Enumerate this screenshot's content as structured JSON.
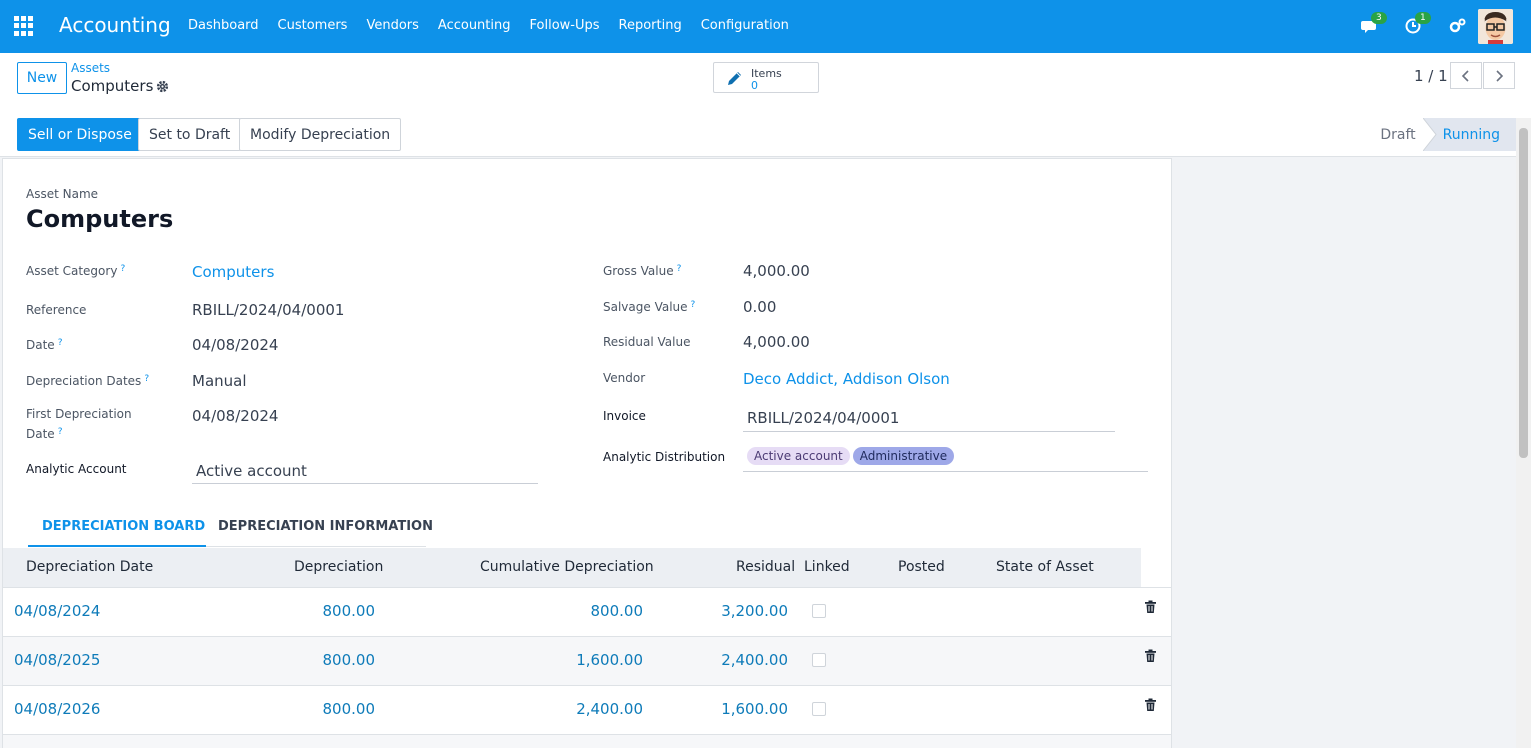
{
  "navbar": {
    "app_name": "Accounting",
    "menu": [
      "Dashboard",
      "Customers",
      "Vendors",
      "Accounting",
      "Follow-Ups",
      "Reporting",
      "Configuration"
    ],
    "messages_count": "3",
    "activities_count": "1",
    "brand_color": "#0e92e9"
  },
  "control": {
    "new_label": "New",
    "breadcrumb_parent": "Assets",
    "breadcrumb_current": "Computers",
    "items_label": "Items",
    "items_count": "0",
    "pager": "1 / 1"
  },
  "actions": {
    "sell_dispose": "Sell or Dispose",
    "set_draft": "Set to Draft",
    "modify_depreciation": "Modify Depreciation"
  },
  "status": {
    "draft": "Draft",
    "running": "Running",
    "current": "Running"
  },
  "form": {
    "asset_name_label": "Asset Name",
    "asset_name": "Computers",
    "left": {
      "category_label": "Asset Category",
      "category": "Computers",
      "reference_label": "Reference",
      "reference": "RBILL/2024/04/0001",
      "date_label": "Date",
      "date": "04/08/2024",
      "dep_dates_label": "Depreciation Dates",
      "dep_dates": "Manual",
      "first_dep_label_1": "First Depreciation",
      "first_dep_label_2": "Date",
      "first_dep": "04/08/2024",
      "analytic_account_label": "Analytic Account",
      "analytic_account": "Active account"
    },
    "right": {
      "gross_label": "Gross Value",
      "gross": "4,000.00",
      "salvage_label": "Salvage Value",
      "salvage": "0.00",
      "residual_label": "Residual Value",
      "residual": "4,000.00",
      "vendor_label": "Vendor",
      "vendor": "Deco Addict, Addison Olson",
      "invoice_label": "Invoice",
      "invoice": "RBILL/2024/04/0001",
      "distribution_label": "Analytic Distribution",
      "tags": [
        "Active account",
        "Administrative"
      ]
    },
    "help_mark": "?"
  },
  "tabs": [
    "DEPRECIATION BOARD",
    "DEPRECIATION INFORMATION"
  ],
  "table": {
    "columns": [
      "Depreciation Date",
      "Depreciation",
      "Cumulative Depreciation",
      "Residual",
      "Linked",
      "Posted",
      "State of Asset"
    ],
    "rows": [
      {
        "date": "04/08/2024",
        "depreciation": "800.00",
        "cumulative": "800.00",
        "residual": "3,200.00",
        "linked": false
      },
      {
        "date": "04/08/2025",
        "depreciation": "800.00",
        "cumulative": "1,600.00",
        "residual": "2,400.00",
        "linked": false
      },
      {
        "date": "04/08/2026",
        "depreciation": "800.00",
        "cumulative": "2,400.00",
        "residual": "1,600.00",
        "linked": false
      }
    ]
  }
}
